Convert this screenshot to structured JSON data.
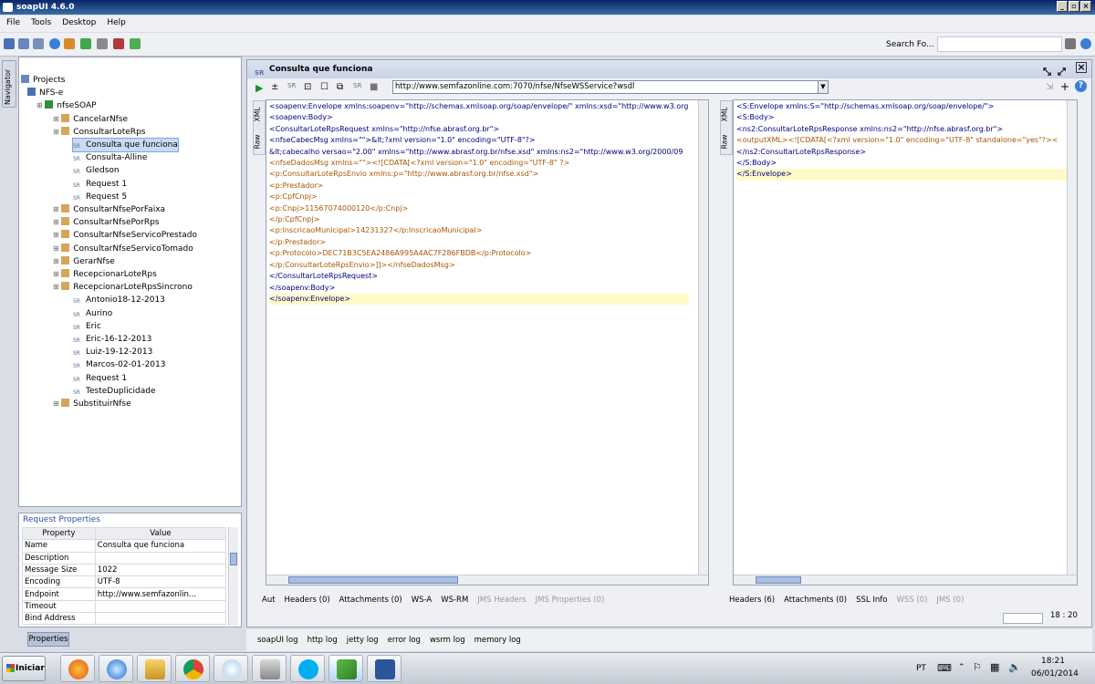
{
  "window": {
    "title": "soapUI 4.6.0"
  },
  "menu": [
    "File",
    "Tools",
    "Desktop",
    "Help"
  ],
  "toolbar": {
    "search_label": "Search Fo..."
  },
  "navigator": {
    "tab_label": "Navigator"
  },
  "tree": [
    {
      "label": "Projects",
      "indent": 0,
      "icon": "projects-icon"
    },
    {
      "label": "NFS-e",
      "indent": 1,
      "icon": "project-icon"
    },
    {
      "label": "nfseSOAP",
      "indent": 2,
      "icon": "interface-icon"
    },
    {
      "label": "CancelarNfse",
      "indent": 3,
      "icon": "operation-icon"
    },
    {
      "label": "ConsultarLoteRps",
      "indent": 3,
      "icon": "operation-icon"
    },
    {
      "label": "Consulta que funciona",
      "indent": 4,
      "icon": "request-icon",
      "selected": true
    },
    {
      "label": "Consulta-Alline",
      "indent": 4,
      "icon": "request-icon"
    },
    {
      "label": "Gledson",
      "indent": 4,
      "icon": "request-icon"
    },
    {
      "label": "Request 1",
      "indent": 4,
      "icon": "request-icon"
    },
    {
      "label": "Request 5",
      "indent": 4,
      "icon": "request-icon"
    },
    {
      "label": "ConsultarNfsePorFaixa",
      "indent": 3,
      "icon": "operation-icon"
    },
    {
      "label": "ConsultarNfsePorRps",
      "indent": 3,
      "icon": "operation-icon"
    },
    {
      "label": "ConsultarNfseServicoPrestado",
      "indent": 3,
      "icon": "operation-icon"
    },
    {
      "label": "ConsultarNfseServicoTomado",
      "indent": 3,
      "icon": "operation-icon"
    },
    {
      "label": "GerarNfse",
      "indent": 3,
      "icon": "operation-icon"
    },
    {
      "label": "RecepcionarLoteRps",
      "indent": 3,
      "icon": "operation-icon"
    },
    {
      "label": "RecepcionarLoteRpsSincrono",
      "indent": 3,
      "icon": "operation-icon"
    },
    {
      "label": "Antonio18-12-2013",
      "indent": 4,
      "icon": "request-icon"
    },
    {
      "label": "Aurino",
      "indent": 4,
      "icon": "request-icon"
    },
    {
      "label": "Eric",
      "indent": 4,
      "icon": "request-icon"
    },
    {
      "label": "Eric-16-12-2013",
      "indent": 4,
      "icon": "request-icon"
    },
    {
      "label": "Luiz-19-12-2013",
      "indent": 4,
      "icon": "request-icon"
    },
    {
      "label": "Marcos-02-01-2013",
      "indent": 4,
      "icon": "request-icon"
    },
    {
      "label": "Request 1",
      "indent": 4,
      "icon": "request-icon"
    },
    {
      "label": "TesteDuplicidade",
      "indent": 4,
      "icon": "request-icon"
    },
    {
      "label": "SubstituirNfse",
      "indent": 3,
      "icon": "operation-icon"
    }
  ],
  "request_properties": {
    "header": "Request Properties",
    "col_property": "Property",
    "col_value": "Value",
    "rows": [
      {
        "name": "Name",
        "value": "Consulta que funciona"
      },
      {
        "name": "Description",
        "value": ""
      },
      {
        "name": "Message Size",
        "value": "1022"
      },
      {
        "name": "Encoding",
        "value": "UTF-8"
      },
      {
        "name": "Endpoint",
        "value": "http://www.semfazonlin..."
      },
      {
        "name": "Timeout",
        "value": ""
      },
      {
        "name": "Bind Address",
        "value": ""
      }
    ],
    "button": "Properties"
  },
  "editor": {
    "title": "Consulta que funciona",
    "endpoint": "http://www.semfazonline.com:7070/nfse/NfseWSService?wsdl",
    "request_tabs_side": [
      "XML",
      "Raw"
    ],
    "response_tabs_side": [
      "XML",
      "Raw"
    ],
    "request_xml": [
      "<soapenv:Envelope xmlns:soapenv=\"http://schemas.xmlsoap.org/soap/envelope/\" xmlns:xsd=\"http://www.w3.org",
      "  <soapenv:Body>",
      "    <ConsultarLoteRpsRequest xmlns=\"http://nfse.abrasf.org.br\">",
      "      <nfseCabecMsg xmlns=\"\">&lt;?xml version=\"1.0\" encoding=\"UTF-8\"?>",
      "&lt;cabecalho versao=\"2.00\" xmlns=\"http://www.abrasf.org.br/nfse.xsd\" xmlns:ns2=\"http://www.w3.org/2000/09",
      "      <nfseDadosMsg xmlns=\"\"><![CDATA[<?xml version=\"1.0\" encoding=\"UTF-8\" ?>",
      "<p:ConsultarLoteRpsEnvio xmlns:p=\"http://www.abrasf.org.br/nfse.xsd\">",
      "  <p:Prestador>",
      "    <p:CpfCnpj>",
      "      <p:Cnpj>11567074000120</p:Cnpj>",
      "    </p:CpfCnpj>",
      "    <p:InscricaoMunicipal>14231327</p:InscricaoMunicipal>",
      "  </p:Prestador>",
      "  <p:Protocolo>DEC71B3C5EA2486A995A4AC7F286FBDB</p:Protocolo>",
      "</p:ConsultarLoteRpsEnvio>]]></nfseDadosMsg>",
      "    </ConsultarLoteRpsRequest>",
      "  </soapenv:Body>",
      "</soapenv:Envelope>"
    ],
    "response_xml": [
      "<S:Envelope xmlns:S=\"http://schemas.xmlsoap.org/soap/envelope/\">",
      "  <S:Body>",
      "    <ns2:ConsultarLoteRpsResponse xmlns:ns2=\"http://nfse.abrasf.org.br\">",
      "      <outputXML><![CDATA[<?xml version=\"1.0\" encoding=\"UTF-8\" standalone=\"yes\"?><",
      "    </ns2:ConsultarLoteRpsResponse>",
      "  </S:Body>",
      "</S:Envelope>"
    ],
    "request_bottom_tabs": [
      {
        "label": "Aut",
        "disabled": false
      },
      {
        "label": "Headers (0)",
        "disabled": false
      },
      {
        "label": "Attachments (0)",
        "disabled": false
      },
      {
        "label": "WS-A",
        "disabled": false
      },
      {
        "label": "WS-RM",
        "disabled": false
      },
      {
        "label": "JMS Headers",
        "disabled": true
      },
      {
        "label": "JMS Properties (0)",
        "disabled": true
      }
    ],
    "response_bottom_tabs": [
      {
        "label": "Headers (6)",
        "disabled": false
      },
      {
        "label": "Attachments (0)",
        "disabled": false
      },
      {
        "label": "SSL Info",
        "disabled": false
      },
      {
        "label": "WSS (0)",
        "disabled": true
      },
      {
        "label": "JMS (0)",
        "disabled": true
      }
    ],
    "cursor_pos": "18 : 20"
  },
  "log_tabs": [
    "soapUI log",
    "http log",
    "jetty log",
    "error log",
    "wsrm log",
    "memory log"
  ],
  "taskbar": {
    "start": "Iniciar",
    "lang": "PT",
    "time": "18:21",
    "date": "06/01/2014"
  },
  "colors": {
    "accent": "#0a246a",
    "selection": "#c9daf4",
    "highlight": "#fefbc8"
  }
}
